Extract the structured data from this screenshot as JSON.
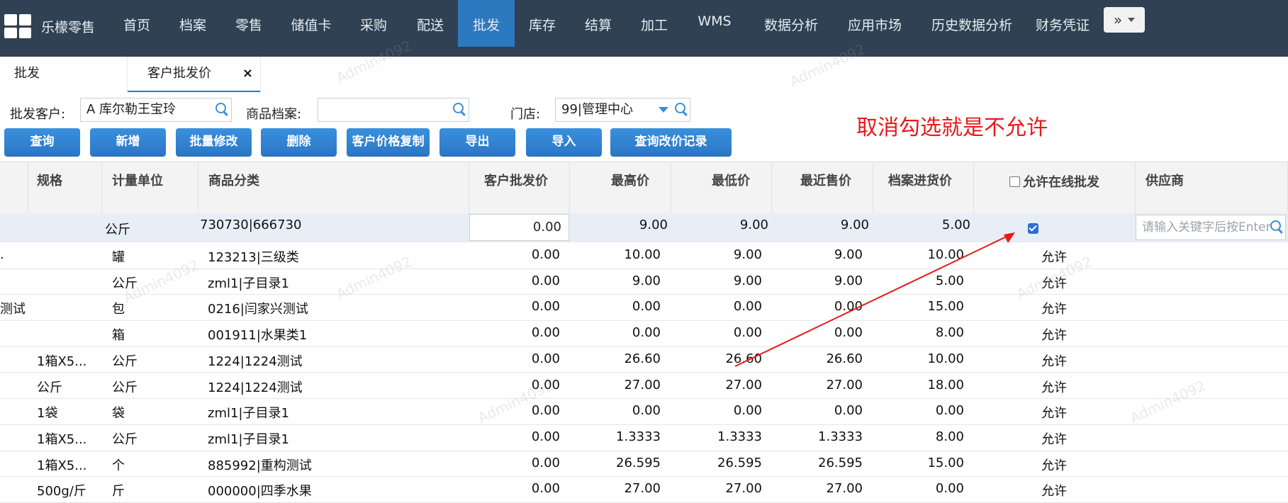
{
  "topnav": {
    "brand": "乐檬零售",
    "items": [
      "首页",
      "档案",
      "零售",
      "储值卡",
      "采购",
      "配送",
      "批发",
      "库存",
      "结算",
      "加工",
      "WMS",
      "数据分析",
      "应用市场",
      "历史数据分析",
      "财务凭证"
    ],
    "active_index": 6,
    "more_label": "»"
  },
  "tabs": [
    {
      "label": "批发"
    },
    {
      "label": "客户批发价",
      "close": "×"
    }
  ],
  "filters": {
    "customer_label": "批发客户:",
    "customer_value": "A 库尔勒王宝玲",
    "product_label": "商品档案:",
    "product_value": "",
    "store_label": "门店:",
    "store_value": "99|管理中心"
  },
  "note": "取消勾选就是不允许",
  "buttons": [
    "查询",
    "新增",
    "批量修改",
    "删除",
    "客户价格复制",
    "导出",
    "导入",
    "查询改价记录"
  ],
  "grid": {
    "headers": {
      "spec": "规格",
      "unit": "计量单位",
      "category": "商品分类",
      "customer_price": "客户批发价",
      "max_price": "最高价",
      "min_price": "最低价",
      "recent_price": "最近售价",
      "purchase_price": "档案进货价",
      "allow_online": "允许在线批发",
      "supplier": "供应商"
    },
    "edit_row": {
      "unit": "公斤",
      "category": "730730|666730",
      "customer_price": "0.00",
      "max_price": "9.00",
      "min_price": "9.00",
      "recent_price": "9.00",
      "purchase_price": "5.00",
      "allow_online_checked": true,
      "supplier_placeholder": "请输入关键字后按Enter"
    },
    "rows": [
      {
        "lead": ".",
        "spec": "",
        "unit": "罐",
        "category": "123213|三级类",
        "customer_price": "0.00",
        "max_price": "10.00",
        "min_price": "9.00",
        "recent_price": "9.00",
        "purchase_price": "10.00",
        "allow": "允许"
      },
      {
        "lead": "",
        "spec": "",
        "unit": "公斤",
        "category": "zml1|子目录1",
        "customer_price": "0.00",
        "max_price": "9.00",
        "min_price": "9.00",
        "recent_price": "9.00",
        "purchase_price": "5.00",
        "allow": "允许"
      },
      {
        "lead": "测试",
        "spec": "",
        "unit": "包",
        "category": "0216|闫家兴测试",
        "customer_price": "0.00",
        "max_price": "0.00",
        "min_price": "0.00",
        "recent_price": "0.00",
        "purchase_price": "15.00",
        "allow": "允许"
      },
      {
        "lead": "",
        "spec": "",
        "unit": "箱",
        "category": "001911|水果类1",
        "customer_price": "0.00",
        "max_price": "0.00",
        "min_price": "0.00",
        "recent_price": "0.00",
        "purchase_price": "8.00",
        "allow": "允许"
      },
      {
        "lead": "",
        "spec": "1箱X5...",
        "unit": "公斤",
        "category": "1224|1224测试",
        "customer_price": "0.00",
        "max_price": "26.60",
        "min_price": "26.60",
        "recent_price": "26.60",
        "purchase_price": "10.00",
        "allow": "允许"
      },
      {
        "lead": "",
        "spec": "公斤",
        "unit": "公斤",
        "category": "1224|1224测试",
        "customer_price": "0.00",
        "max_price": "27.00",
        "min_price": "27.00",
        "recent_price": "27.00",
        "purchase_price": "18.00",
        "allow": "允许"
      },
      {
        "lead": "",
        "spec": "1袋",
        "unit": "袋",
        "category": "zml1|子目录1",
        "customer_price": "0.00",
        "max_price": "0.00",
        "min_price": "0.00",
        "recent_price": "0.00",
        "purchase_price": "0.00",
        "allow": "允许"
      },
      {
        "lead": "",
        "spec": "1箱X5...",
        "unit": "公斤",
        "category": "zml1|子目录1",
        "customer_price": "0.00",
        "max_price": "1.3333",
        "min_price": "1.3333",
        "recent_price": "1.3333",
        "purchase_price": "8.00",
        "allow": "允许"
      },
      {
        "lead": "",
        "spec": "1箱X5...",
        "unit": "个",
        "category": "885992|重构测试",
        "customer_price": "0.00",
        "max_price": "26.595",
        "min_price": "26.595",
        "recent_price": "26.595",
        "purchase_price": "15.00",
        "allow": "允许"
      },
      {
        "lead": "",
        "spec": "500g/斤",
        "unit": "斤",
        "category": "000000|四季水果",
        "customer_price": "0.00",
        "max_price": "27.00",
        "min_price": "27.00",
        "recent_price": "27.00",
        "purchase_price": "0.00",
        "allow": "允许"
      }
    ]
  },
  "watermark_text": "Admin4092",
  "colors": {
    "nav_bg": "#2f4152",
    "accent": "#2c79c0",
    "note": "#e8191b"
  }
}
